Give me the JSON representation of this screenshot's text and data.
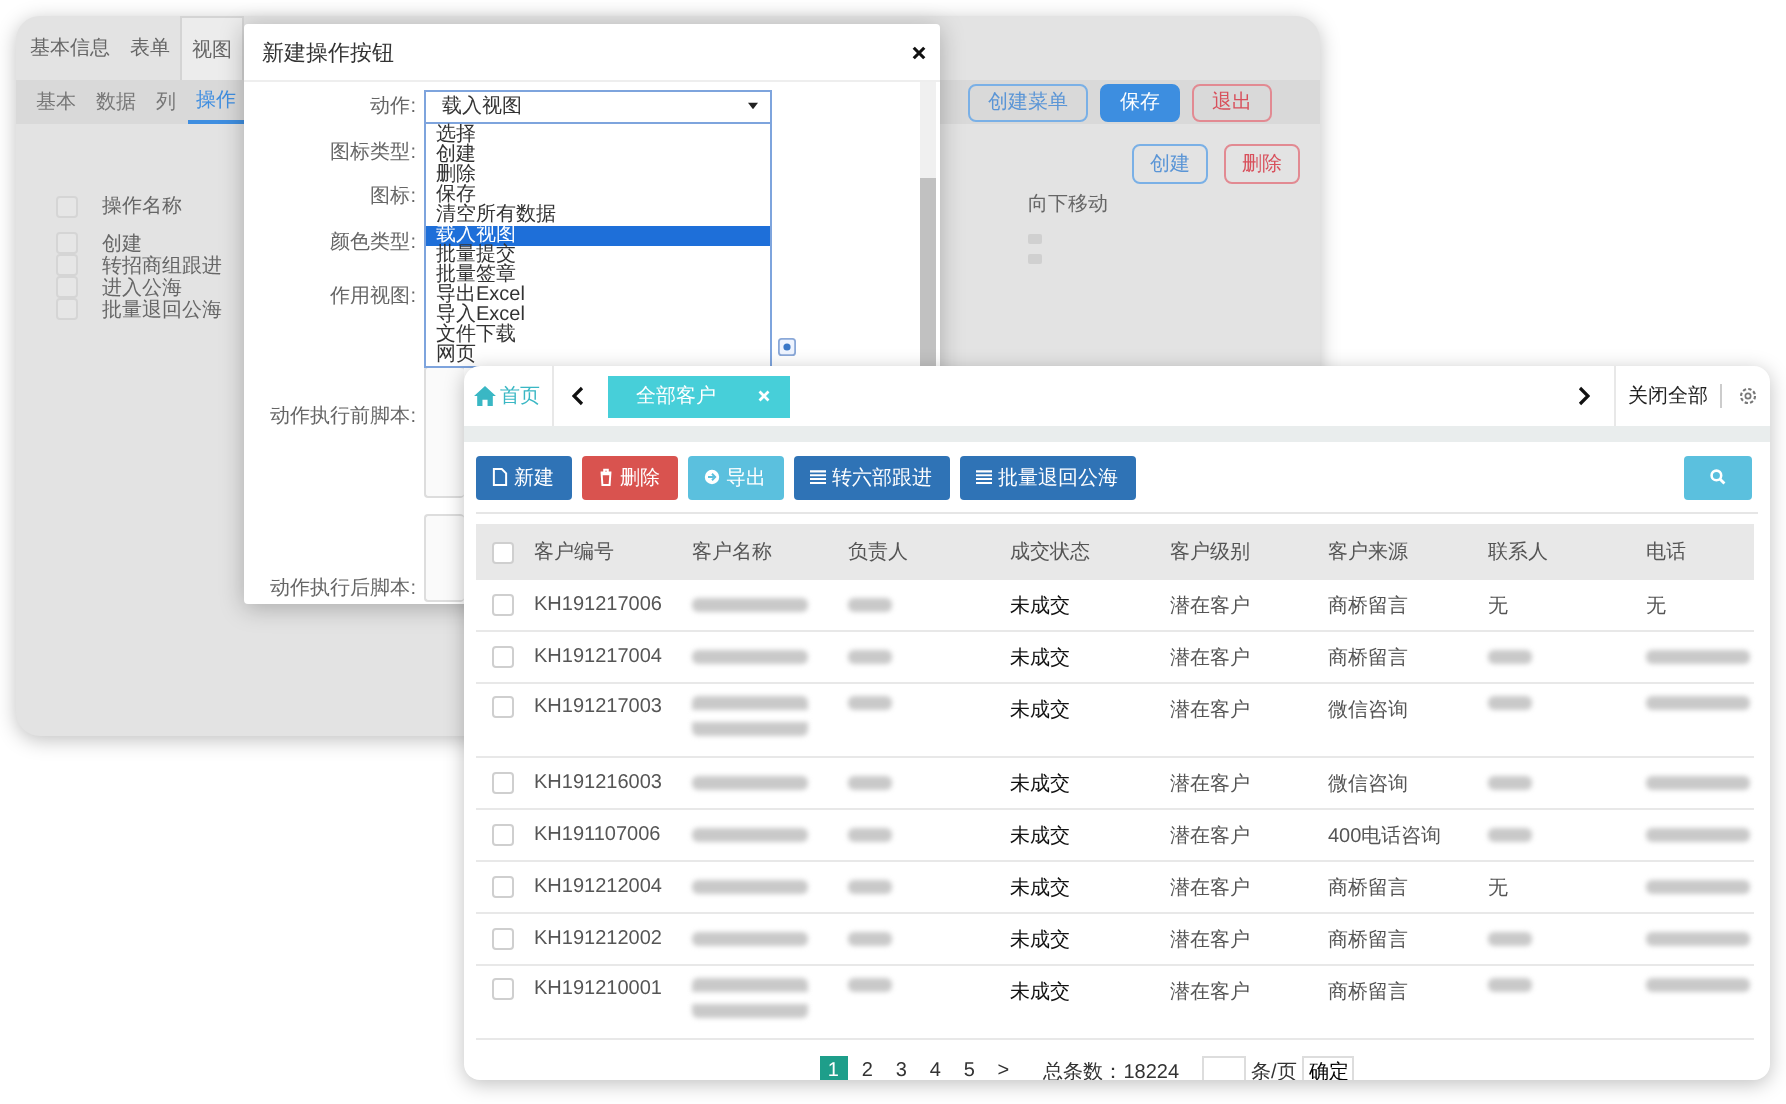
{
  "background_window": {
    "tabs": [
      {
        "label": "基本信息",
        "selected": false
      },
      {
        "label": "表单",
        "selected": false
      },
      {
        "label": "视图",
        "selected": true
      }
    ],
    "subtabs": [
      {
        "label": "基本",
        "selected": false
      },
      {
        "label": "数据",
        "selected": false
      },
      {
        "label": "列",
        "selected": false
      },
      {
        "label": "操作",
        "selected": true
      }
    ],
    "header_buttons": [
      {
        "label": "创建菜单",
        "kind": "outline-blue"
      },
      {
        "label": "保存",
        "kind": "primary"
      },
      {
        "label": "退出",
        "kind": "outline-red"
      }
    ],
    "list_buttons": [
      {
        "label": "创建",
        "kind": "outline-blue"
      },
      {
        "label": "删除",
        "kind": "outline-red"
      }
    ],
    "list": {
      "header": "操作名称",
      "header_checked": false,
      "items": [
        {
          "label": "创建",
          "checked": false
        },
        {
          "label": "转招商组跟进",
          "checked": false
        },
        {
          "label": "进入公海",
          "checked": false
        },
        {
          "label": "批量退回公海",
          "checked": false
        }
      ]
    },
    "move_column": {
      "header": "向下移动"
    }
  },
  "dialog": {
    "title": "新建操作按钮",
    "fields": [
      {
        "label": "动作:",
        "kind": "select",
        "value": "载入视图"
      },
      {
        "label": "图标类型:",
        "kind": "blank"
      },
      {
        "label": "图标:",
        "kind": "blank"
      },
      {
        "label": "颜色类型:",
        "kind": "blank"
      },
      {
        "label": "作用视图:",
        "kind": "blank"
      },
      {
        "label": "动作执行前脚本:",
        "kind": "textarea"
      },
      {
        "label": "动作执行后脚本:",
        "kind": "textarea"
      }
    ],
    "dropdown": {
      "options": [
        {
          "label": "选择",
          "selected": false
        },
        {
          "label": "创建",
          "selected": false
        },
        {
          "label": "删除",
          "selected": false
        },
        {
          "label": "保存",
          "selected": false
        },
        {
          "label": "清空所有数据",
          "selected": false
        },
        {
          "label": "载入视图",
          "selected": true
        },
        {
          "label": "批量提交",
          "selected": false
        },
        {
          "label": "批量签章",
          "selected": false
        },
        {
          "label": "导出Excel",
          "selected": false
        },
        {
          "label": "导入Excel",
          "selected": false
        },
        {
          "label": "文件下载",
          "selected": false
        },
        {
          "label": "网页",
          "selected": false
        }
      ]
    }
  },
  "main_window": {
    "home_tab": "首页",
    "open_tabs": [
      {
        "label": "全部客户",
        "selected": true
      }
    ],
    "close_all": "关闭全部",
    "toolbar": [
      {
        "label": "新建",
        "kind": "create"
      },
      {
        "label": "删除",
        "kind": "delete"
      },
      {
        "label": "导出",
        "kind": "export"
      },
      {
        "label": "转六部跟进",
        "kind": "list"
      },
      {
        "label": "批量退回公海",
        "kind": "list"
      }
    ],
    "table": {
      "header_checked": false,
      "columns": [
        "客户编号",
        "客户名称",
        "负责人",
        "成交状态",
        "客户级别",
        "客户来源",
        "联系人",
        "电话"
      ],
      "rows": [
        {
          "checked": false,
          "wrapped": false,
          "cells": [
            "KH191217006",
            null,
            null,
            "未成交",
            "潜在客户",
            "商桥留言",
            "无",
            "无"
          ]
        },
        {
          "checked": false,
          "wrapped": false,
          "cells": [
            "KH191217004",
            null,
            null,
            "未成交",
            "潜在客户",
            "商桥留言",
            null,
            null
          ]
        },
        {
          "checked": false,
          "wrapped": true,
          "cells": [
            "KH191217003",
            null,
            null,
            "未成交",
            "潜在客户",
            "微信咨询",
            null,
            null
          ]
        },
        {
          "checked": false,
          "wrapped": false,
          "cells": [
            "KH191216003",
            null,
            null,
            "未成交",
            "潜在客户",
            "微信咨询",
            null,
            null
          ]
        },
        {
          "checked": false,
          "wrapped": false,
          "cells": [
            "KH191107006",
            null,
            null,
            "未成交",
            "潜在客户",
            "400电话咨询",
            null,
            null
          ]
        },
        {
          "checked": false,
          "wrapped": false,
          "cells": [
            "KH191212004",
            null,
            null,
            "未成交",
            "潜在客户",
            "商桥留言",
            "无",
            null
          ]
        },
        {
          "checked": false,
          "wrapped": false,
          "cells": [
            "KH191212002",
            null,
            null,
            "未成交",
            "潜在客户",
            "商桥留言",
            null,
            null
          ]
        },
        {
          "checked": false,
          "wrapped": true,
          "cells": [
            "KH191210001",
            null,
            null,
            "未成交",
            "潜在客户",
            "商桥留言",
            null,
            null
          ]
        }
      ]
    },
    "pagination": {
      "pages": [
        {
          "label": "1",
          "selected": true
        },
        {
          "label": "2",
          "selected": false
        },
        {
          "label": "3",
          "selected": false
        },
        {
          "label": "4",
          "selected": false
        },
        {
          "label": "5",
          "selected": false
        }
      ],
      "next": ">",
      "total": "总条数：18224",
      "per_page_unit": "条/页",
      "confirm": "确定"
    }
  }
}
